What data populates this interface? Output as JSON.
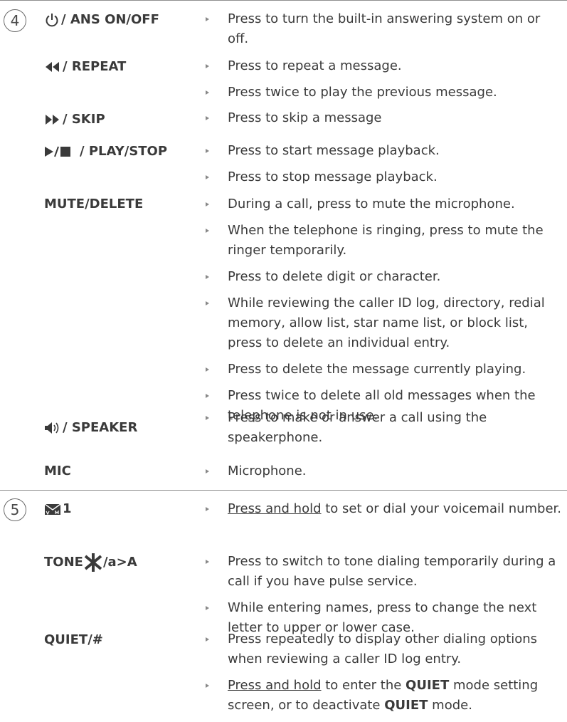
{
  "sections": [
    {
      "number": "4",
      "rows": [
        {
          "key": "/ ANS ON/OFF",
          "icon": "power-icon",
          "items": [
            "Press to turn the built-in answering system on or off."
          ]
        },
        {
          "key": "/ REPEAT",
          "icon": "rewind-icon",
          "items": [
            "Press to repeat a message.",
            "Press twice to play the previous message."
          ]
        },
        {
          "key": "/ SKIP",
          "icon": "fast-forward-icon",
          "items": [
            "Press to skip a message"
          ]
        },
        {
          "key": "/ PLAY/STOP",
          "icon": "play-stop-icon",
          "items": [
            "Press to start message playback.",
            "Press to stop message playback."
          ]
        },
        {
          "key": "MUTE/DELETE",
          "icon": "",
          "items": [
            "During a call, press to mute the microphone.",
            "When the telephone is ringing, press to mute the ringer temporarily.",
            "Press to delete digit or character.",
            "While reviewing the caller ID log, directory, redial memory, allow list, star name list, or block list, press to delete an individual entry.",
            "Press to delete the message currently playing.",
            "Press twice to delete all old messages when the telephone is not in use."
          ]
        },
        {
          "key": "/ SPEAKER",
          "icon": "speaker-icon",
          "items": [
            "Press to make or answer a call using the speakerphone."
          ]
        },
        {
          "key": "MIC",
          "icon": "",
          "items": [
            "Microphone."
          ]
        }
      ]
    },
    {
      "number": "5",
      "rows": [
        {
          "key": "1",
          "icon": "voicemail-icon",
          "items": [
            {
              "u": "Press and hold",
              "t": " to set or dial your voicemail number."
            }
          ]
        },
        {
          "key_pre": "TONE",
          "key_post": "/a>A",
          "icon": "tone-star-icon",
          "items": [
            "Press to switch to tone dialing temporarily during a call if you have pulse service.",
            "While entering names, press to change the next letter to upper or lower case."
          ]
        },
        {
          "key": "QUIET/#",
          "icon": "",
          "items": [
            "Press repeatedly to display other dialing options when reviewing a caller ID log entry.",
            {
              "u": "Press and hold",
              "t1": " to enter the ",
              "b1": "QUIET",
              "t2": " mode setting screen, or to deactivate ",
              "b2": "QUIET",
              "t3": " mode."
            }
          ]
        }
      ]
    }
  ]
}
